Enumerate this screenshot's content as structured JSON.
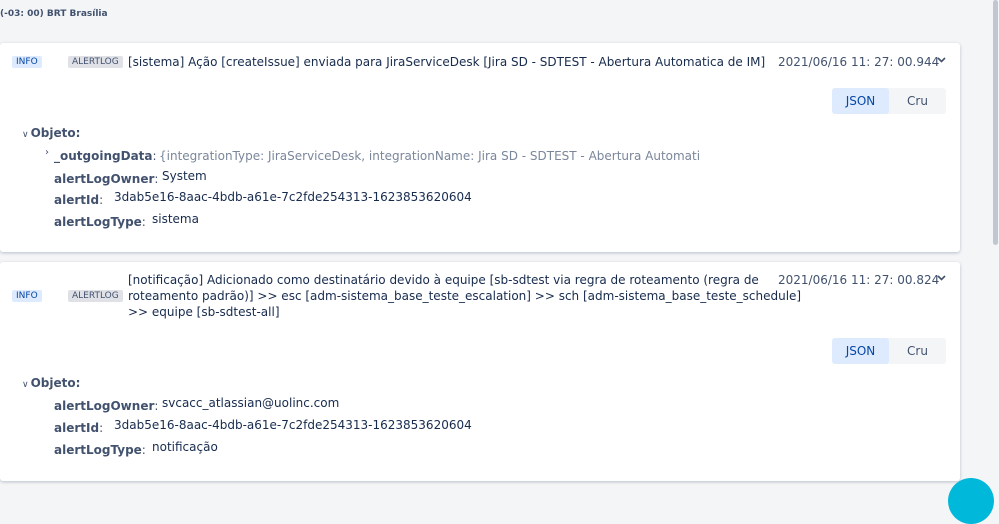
{
  "timezone": "(-03: 00) BRT Brasília",
  "entries": [
    {
      "level": "INFO",
      "type": "ALERTLOG",
      "message": "[sistema] Ação [createIssue] enviada para JiraServiceDesk [Jira SD - SDTEST - Abertura Automatica de IM]",
      "timestamp": "2021/06/16 11: 27: 00.944",
      "view_json": "JSON",
      "view_raw": "Cru",
      "object_label": "Objeto:",
      "fields": [
        {
          "key": "_outgoingData",
          "value": "{integrationType: JiraServiceDesk, integrationName: Jira SD - SDTEST - Abertura Automati"
        },
        {
          "key": "alertLogOwner",
          "value": "System"
        },
        {
          "key": "alertId",
          "value": "3dab5e16-8aac-4bdb-a61e-7c2fde254313-1623853620604"
        },
        {
          "key": "alertLogType",
          "value": "sistema"
        }
      ]
    },
    {
      "level": "INFO",
      "type": "ALERTLOG",
      "message_lines": [
        "[notificação] Adicionado como destinatário devido à equipe [sb-sdtest via regra de roteamento (regra de",
        "roteamento padrão)] >> esc [adm-sistema_base_teste_escalation] >> sch [adm-sistema_base_teste_schedule]",
        ">> equipe [sb-sdtest-all]"
      ],
      "timestamp": "2021/06/16 11: 27: 00.824",
      "view_json": "JSON",
      "view_raw": "Cru",
      "object_label": "Objeto:",
      "fields": [
        {
          "key": "alertLogOwner",
          "value": "svcacc_atlassian@uolinc.com"
        },
        {
          "key": "alertId",
          "value": "3dab5e16-8aac-4bdb-a61e-7c2fde254313-1623853620604"
        },
        {
          "key": "alertLogType",
          "value": "notificação"
        }
      ]
    }
  ],
  "colors": {
    "accent": "#0747a6",
    "info_bg": "#deebff",
    "page_bg": "#f4f5f7"
  }
}
